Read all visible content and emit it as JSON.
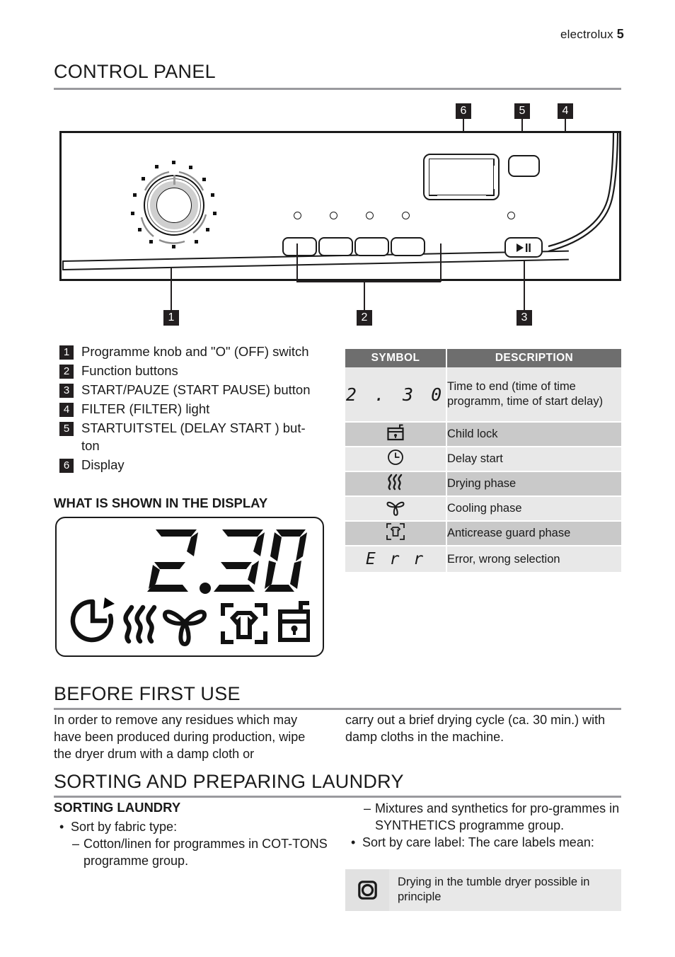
{
  "header": {
    "brand": "electrolux",
    "page": "5"
  },
  "sections": {
    "control_panel": "CONTROL PANEL",
    "what_is_shown": "WHAT IS SHOWN IN THE DISPLAY",
    "before_first_use": "BEFORE FIRST USE",
    "sorting_preparing": "SORTING AND PREPARING LAUNDRY",
    "sorting_laundry": "SORTING LAUNDRY"
  },
  "panel_callouts": [
    "1",
    "2",
    "3",
    "4",
    "5",
    "6"
  ],
  "legend": [
    {
      "num": "1",
      "text": "Programme knob and \"O\" (OFF) switch"
    },
    {
      "num": "2",
      "text": "Function buttons"
    },
    {
      "num": "3",
      "text": "START/PAUZE (START PAUSE) button"
    },
    {
      "num": "4",
      "text": "FILTER (FILTER) light"
    },
    {
      "num": "5",
      "text": "STARTUITSTEL (DELAY START ) but-ton"
    },
    {
      "num": "6",
      "text": "Display"
    }
  ],
  "symbol_table": {
    "headers": [
      "SYMBOL",
      "DESCRIPTION"
    ],
    "rows": [
      {
        "symbol": "2 . 3 0",
        "symbol_kind": "seven-segment",
        "description": "Time to end (time of time programm, time of start delay)"
      },
      {
        "symbol": "child-lock-icon",
        "symbol_kind": "icon",
        "description": "Child lock"
      },
      {
        "symbol": "delay-start-icon",
        "symbol_kind": "icon",
        "description": "Delay start"
      },
      {
        "symbol": "drying-phase-icon",
        "symbol_kind": "icon",
        "description": "Drying phase"
      },
      {
        "symbol": "cooling-phase-icon",
        "symbol_kind": "icon",
        "description": "Cooling phase"
      },
      {
        "symbol": "anticrease-guard-icon",
        "symbol_kind": "icon",
        "description": "Anticrease guard phase"
      },
      {
        "symbol": "E r r",
        "symbol_kind": "seven-segment",
        "description": "Error, wrong selection"
      }
    ]
  },
  "display_illustration": {
    "digits": "2.30",
    "icons": [
      "delay-start-icon",
      "drying-phase-icon",
      "cooling-phase-icon",
      "anticrease-guard-icon",
      "child-lock-icon"
    ]
  },
  "before_first_use": {
    "col1": "In order to remove any residues which may have been produced during production, wipe the dryer drum with a damp cloth or",
    "col2": "carry out a brief drying cycle (ca. 30 min.) with damp cloths in the machine."
  },
  "sorting": {
    "left": [
      {
        "mark": "•",
        "text": "Sort by fabric type:",
        "level": 0
      },
      {
        "mark": "–",
        "text": "Cotton/linen for programmes in COT-TONS programme group.",
        "level": 1
      }
    ],
    "right": [
      {
        "mark": "–",
        "text": "Mixtures and synthetics for pro-grammes in SYNTHETICS programme group.",
        "level": 1
      },
      {
        "mark": "•",
        "text": "Sort by care label: The care labels mean:",
        "level": 0
      }
    ],
    "care_label": {
      "symbol": "tumble-dry-icon",
      "text": "Drying in the tumble dryer possible in principle"
    }
  },
  "colors": {
    "ink": "#1a1a1a",
    "rule": "#9a9a9e",
    "table_header": "#6e6e6e",
    "row_light": "#e8e8e8",
    "row_dark": "#c9c9c9",
    "callout": "#231f20"
  }
}
